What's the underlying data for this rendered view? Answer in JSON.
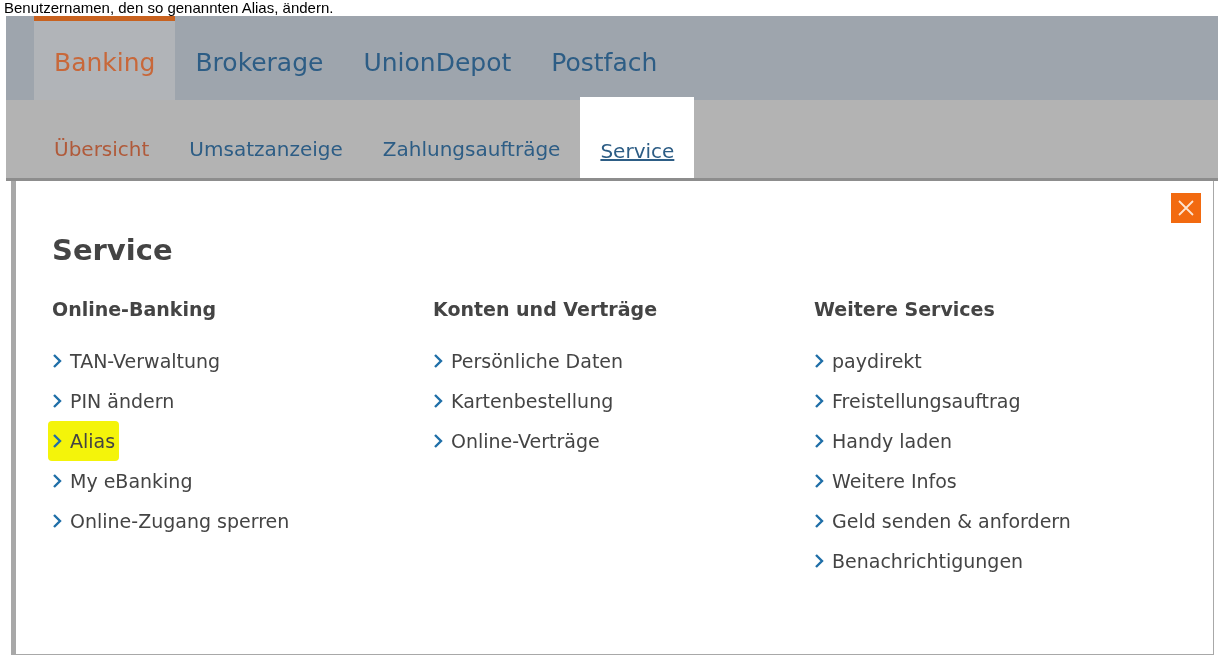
{
  "caption": "Benutzernamen, den so genannten Alias, ändern.",
  "main_tabs": [
    {
      "label": "Banking",
      "selected": true
    },
    {
      "label": "Brokerage",
      "selected": false
    },
    {
      "label": "UnionDepot",
      "selected": false
    },
    {
      "label": "Postfach",
      "selected": false
    }
  ],
  "sub_tabs": [
    {
      "label": "Übersicht",
      "selected": false,
      "current": true
    },
    {
      "label": "Umsatzanzeige",
      "selected": false,
      "current": false
    },
    {
      "label": "Zahlungsaufträge",
      "selected": false,
      "current": false
    },
    {
      "label": "Service",
      "selected": true,
      "current": false
    }
  ],
  "panel": {
    "title": "Service",
    "columns": [
      {
        "heading": "Online-Banking",
        "links": [
          {
            "label": "TAN-Verwaltung",
            "highlighted": false
          },
          {
            "label": "PIN ändern",
            "highlighted": false
          },
          {
            "label": "Alias",
            "highlighted": true
          },
          {
            "label": "My eBanking",
            "highlighted": false
          },
          {
            "label": "Online-Zugang sperren",
            "highlighted": false
          }
        ]
      },
      {
        "heading": "Konten und Verträge",
        "links": [
          {
            "label": "Persönliche Daten",
            "highlighted": false
          },
          {
            "label": "Kartenbestellung",
            "highlighted": false
          },
          {
            "label": "Online-Verträge",
            "highlighted": false
          }
        ]
      },
      {
        "heading": "Weitere Services",
        "links": [
          {
            "label": "paydirekt",
            "highlighted": false
          },
          {
            "label": "Freistellungsauftrag",
            "highlighted": false
          },
          {
            "label": "Handy laden",
            "highlighted": false
          },
          {
            "label": "Weitere Infos",
            "highlighted": false
          },
          {
            "label": "Geld senden & anfordern",
            "highlighted": false
          },
          {
            "label": "Benachrichtigungen",
            "highlighted": false
          }
        ]
      }
    ]
  }
}
